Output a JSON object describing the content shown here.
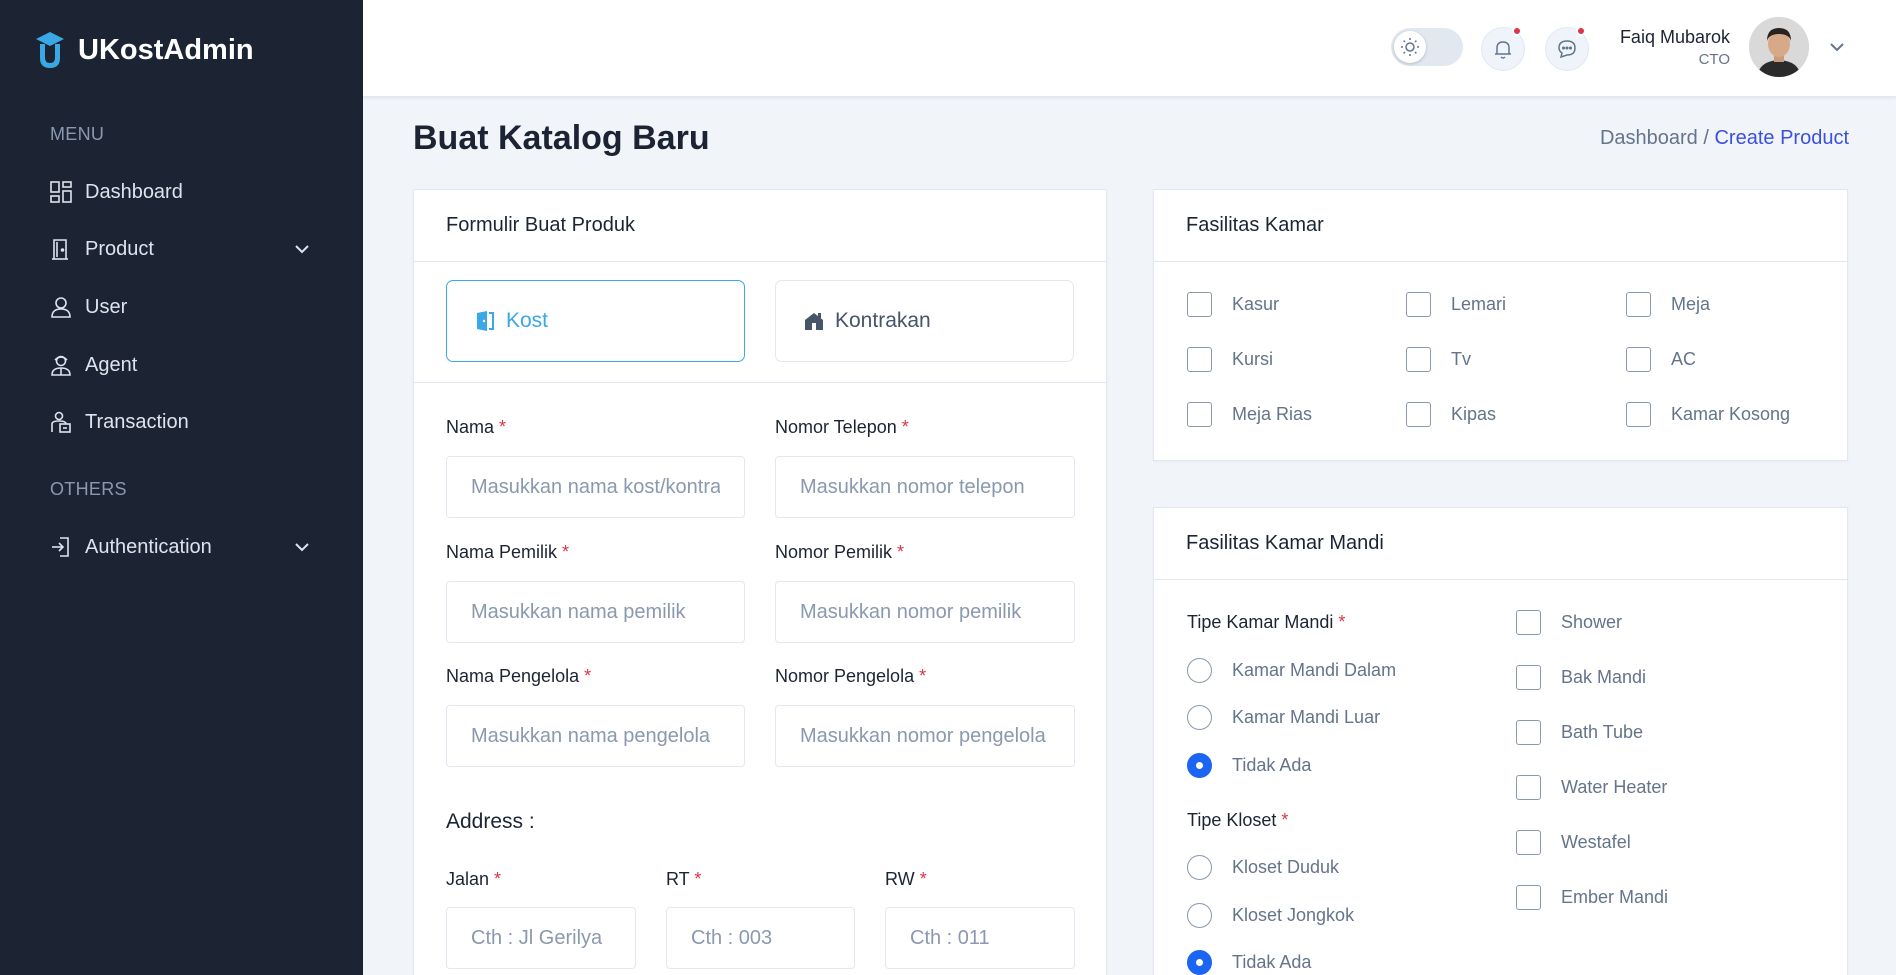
{
  "sidebar": {
    "brand": "UKostAdmin",
    "menu_heading": "MENU",
    "others_heading": "OTHERS",
    "items": [
      {
        "label": "Dashboard",
        "icon": "dashboard-icon"
      },
      {
        "label": "Product",
        "icon": "door-icon"
      },
      {
        "label": "User",
        "icon": "user-icon"
      },
      {
        "label": "Agent",
        "icon": "agent-icon"
      },
      {
        "label": "Transaction",
        "icon": "transaction-icon"
      }
    ],
    "auth_label": "Authentication"
  },
  "header": {
    "user_name": "Faiq Mubarok",
    "user_role": "CTO"
  },
  "page": {
    "title": "Buat Katalog Baru",
    "breadcrumb_home": "Dashboard /",
    "breadcrumb_current": "Create Product"
  },
  "form": {
    "card_title": "Formulir Buat Produk",
    "type_kost": "Kost",
    "type_kontrakan": "Kontrakan",
    "selected_type": "Kost",
    "nama_label": "Nama",
    "nama_placeholder": "Masukkan nama kost/kontrakan",
    "telepon_label": "Nomor Telepon",
    "telepon_placeholder": "Masukkan nomor telepon",
    "pemilik_label": "Nama Pemilik",
    "pemilik_placeholder": "Masukkan nama pemilik",
    "nomor_pemilik_label": "Nomor Pemilik",
    "nomor_pemilik_placeholder": "Masukkan nomor pemilik",
    "pengelola_label": "Nama Pengelola",
    "pengelola_placeholder": "Masukkan nama pengelola",
    "nomor_pengelola_label": "Nomor Pengelola",
    "nomor_pengelola_placeholder": "Masukkan nomor pengelola",
    "address_title": "Address :",
    "jalan_label": "Jalan",
    "jalan_placeholder": "Cth : Jl Gerilya",
    "rt_label": "RT",
    "rt_placeholder": "Cth : 003",
    "rw_label": "RW",
    "rw_placeholder": "Cth : 011",
    "required_mark": "*"
  },
  "fasilitas_kamar": {
    "title": "Fasilitas Kamar",
    "items": [
      "Kasur",
      "Lemari",
      "Meja",
      "Kursi",
      "Tv",
      "AC",
      "Meja Rias",
      "Kipas",
      "Kamar Kosong"
    ]
  },
  "fasilitas_kamar_mandi": {
    "title": "Fasilitas Kamar Mandi",
    "tipe_label": "Tipe Kamar Mandi",
    "tipe_options": [
      "Kamar Mandi Dalam",
      "Kamar Mandi Luar",
      "Tidak Ada"
    ],
    "tipe_selected": "Tidak Ada",
    "kloset_label": "Tipe Kloset",
    "kloset_options": [
      "Kloset Duduk",
      "Kloset Jongkok",
      "Tidak Ada"
    ],
    "kloset_selected": "Tidak Ada",
    "extras": [
      "Shower",
      "Bak Mandi",
      "Bath Tube",
      "Water Heater",
      "Westafel",
      "Ember Mandi"
    ]
  }
}
